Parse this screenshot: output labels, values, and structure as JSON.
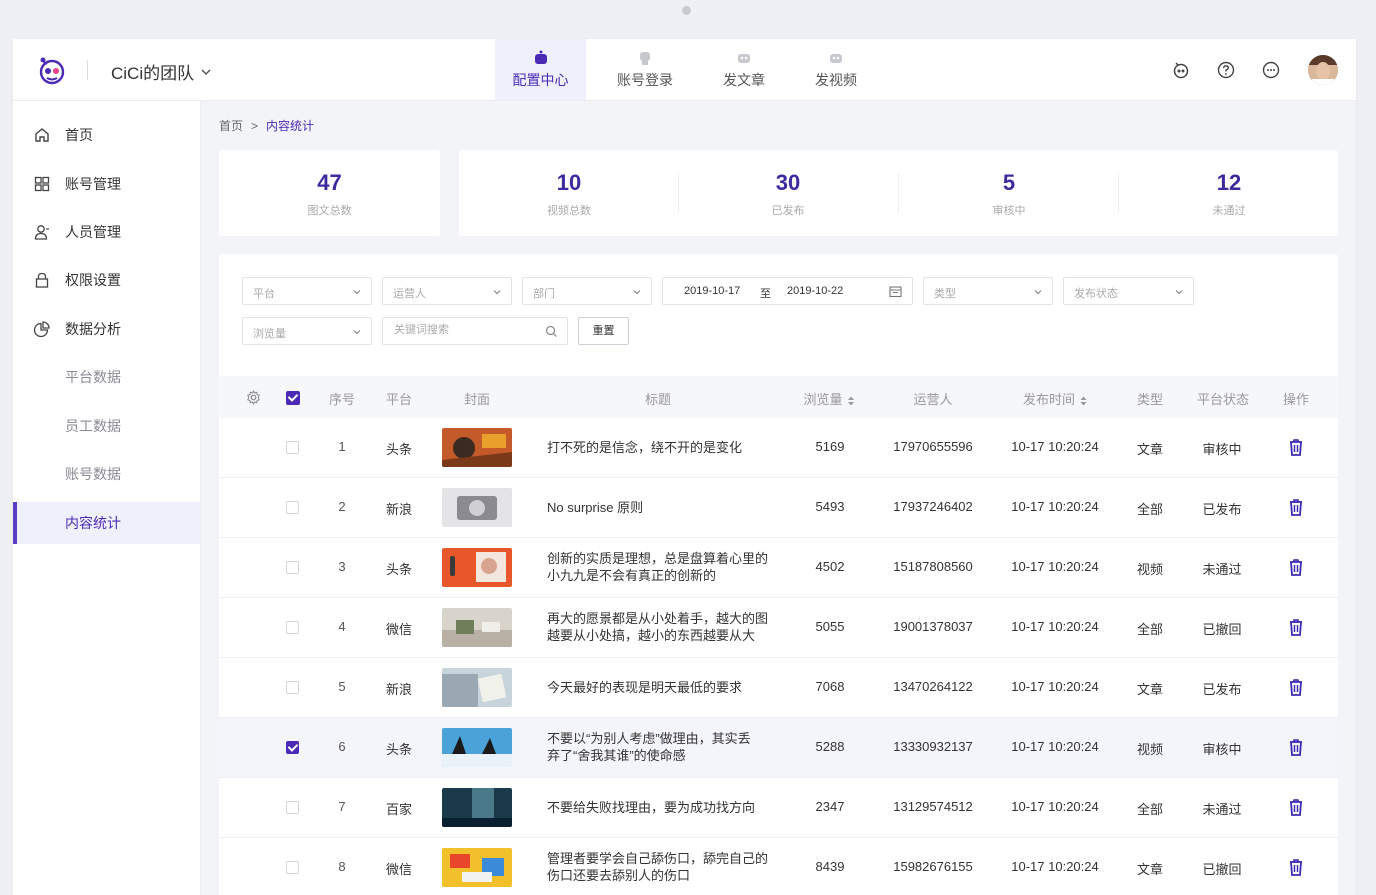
{
  "header": {
    "team_name": "CiCi的团队",
    "nav_tabs": [
      {
        "label": "配置中心",
        "active": true
      },
      {
        "label": "账号登录",
        "active": false
      },
      {
        "label": "发文章",
        "active": false
      },
      {
        "label": "发视频",
        "active": false
      }
    ],
    "icons": [
      "robot-icon",
      "help-icon",
      "more-icon"
    ]
  },
  "sidebar": {
    "items": [
      {
        "label": "首页",
        "icon": "home-icon"
      },
      {
        "label": "账号管理",
        "icon": "grid-icon"
      },
      {
        "label": "人员管理",
        "icon": "user-icon"
      },
      {
        "label": "权限设置",
        "icon": "lock-icon"
      },
      {
        "label": "数据分析",
        "icon": "pie-chart-icon"
      }
    ],
    "sub_items": [
      {
        "label": "平台数据"
      },
      {
        "label": "员工数据"
      },
      {
        "label": "账号数据"
      },
      {
        "label": "内容统计",
        "active": true
      }
    ]
  },
  "breadcrumb": {
    "home": "首页",
    "separator": ">",
    "current": "内容统计"
  },
  "stats": [
    {
      "value": "47",
      "label": "图文总数"
    },
    {
      "value": "10",
      "label": "视频总数"
    },
    {
      "value": "30",
      "label": "已发布"
    },
    {
      "value": "5",
      "label": "审核中"
    },
    {
      "value": "12",
      "label": "未通过"
    }
  ],
  "filters": {
    "platform": "平台",
    "operator": "运营人",
    "department": "部门",
    "date_start": "2019-10-17",
    "date_to": "至",
    "date_end": "2019-10-22",
    "type": "类型",
    "publish_status": "发布状态",
    "views": "浏览量",
    "keyword_placeholder": "关键词搜索",
    "reset_label": "重置"
  },
  "table": {
    "columns": [
      "序号",
      "平台",
      "封面",
      "标题",
      "浏览量",
      "运营人",
      "发布时间",
      "类型",
      "平台状态",
      "操作"
    ],
    "header_checked": true,
    "rows": [
      {
        "no": "1",
        "platform": "头条",
        "title_lines": [
          "打不死的是信念，绕不开的是变化"
        ],
        "views": "5169",
        "operator": "17970655596",
        "time": "10-17 10:20:24",
        "type": "文章",
        "status": "审核中",
        "checked": false
      },
      {
        "no": "2",
        "platform": "新浪",
        "title_lines": [
          "No surprise 原则"
        ],
        "views": "5493",
        "operator": "17937246402",
        "time": "10-17 10:20:24",
        "type": "全部",
        "status": "已发布",
        "checked": false
      },
      {
        "no": "3",
        "platform": "头条",
        "title_lines": [
          "创新的实质是理想，总是盘算着心里的",
          "小九九是不会有真正的创新的"
        ],
        "views": "4502",
        "operator": "15187808560",
        "time": "10-17 10:20:24",
        "type": "视频",
        "status": "未通过",
        "checked": false
      },
      {
        "no": "4",
        "platform": "微信",
        "title_lines": [
          "再大的愿景都是从小处着手，越大的图",
          "越要从小处搞，越小的东西越要从大"
        ],
        "views": "5055",
        "operator": "19001378037",
        "time": "10-17 10:20:24",
        "type": "全部",
        "status": "已撤回",
        "checked": false
      },
      {
        "no": "5",
        "platform": "新浪",
        "title_lines": [
          "今天最好的表现是明天最低的要求"
        ],
        "views": "7068",
        "operator": "13470264122",
        "time": "10-17 10:20:24",
        "type": "文章",
        "status": "已发布",
        "checked": false
      },
      {
        "no": "6",
        "platform": "头条",
        "title_lines": [
          "不要以“为别人考虑”做理由，其实丢",
          "弃了“舍我其谁”的使命感"
        ],
        "views": "5288",
        "operator": "13330932137",
        "time": "10-17 10:20:24",
        "type": "视频",
        "status": "审核中",
        "checked": true
      },
      {
        "no": "7",
        "platform": "百家",
        "title_lines": [
          "不要给失败找理由，要为成功找方向"
        ],
        "views": "2347",
        "operator": "13129574512",
        "time": "10-17 10:20:24",
        "type": "全部",
        "status": "未通过",
        "checked": false
      },
      {
        "no": "8",
        "platform": "微信",
        "title_lines": [
          "管理者要学会自己舔伤口，舔完自己的",
          "伤口还要去舔别人的伤口"
        ],
        "views": "8439",
        "operator": "15982676155",
        "time": "10-17 10:20:24",
        "type": "文章",
        "status": "已撤回",
        "checked": false
      }
    ]
  },
  "colors": {
    "accent": "#4b2bb5",
    "stat_number": "#3b2b9e",
    "background": "#f3f4f8"
  }
}
